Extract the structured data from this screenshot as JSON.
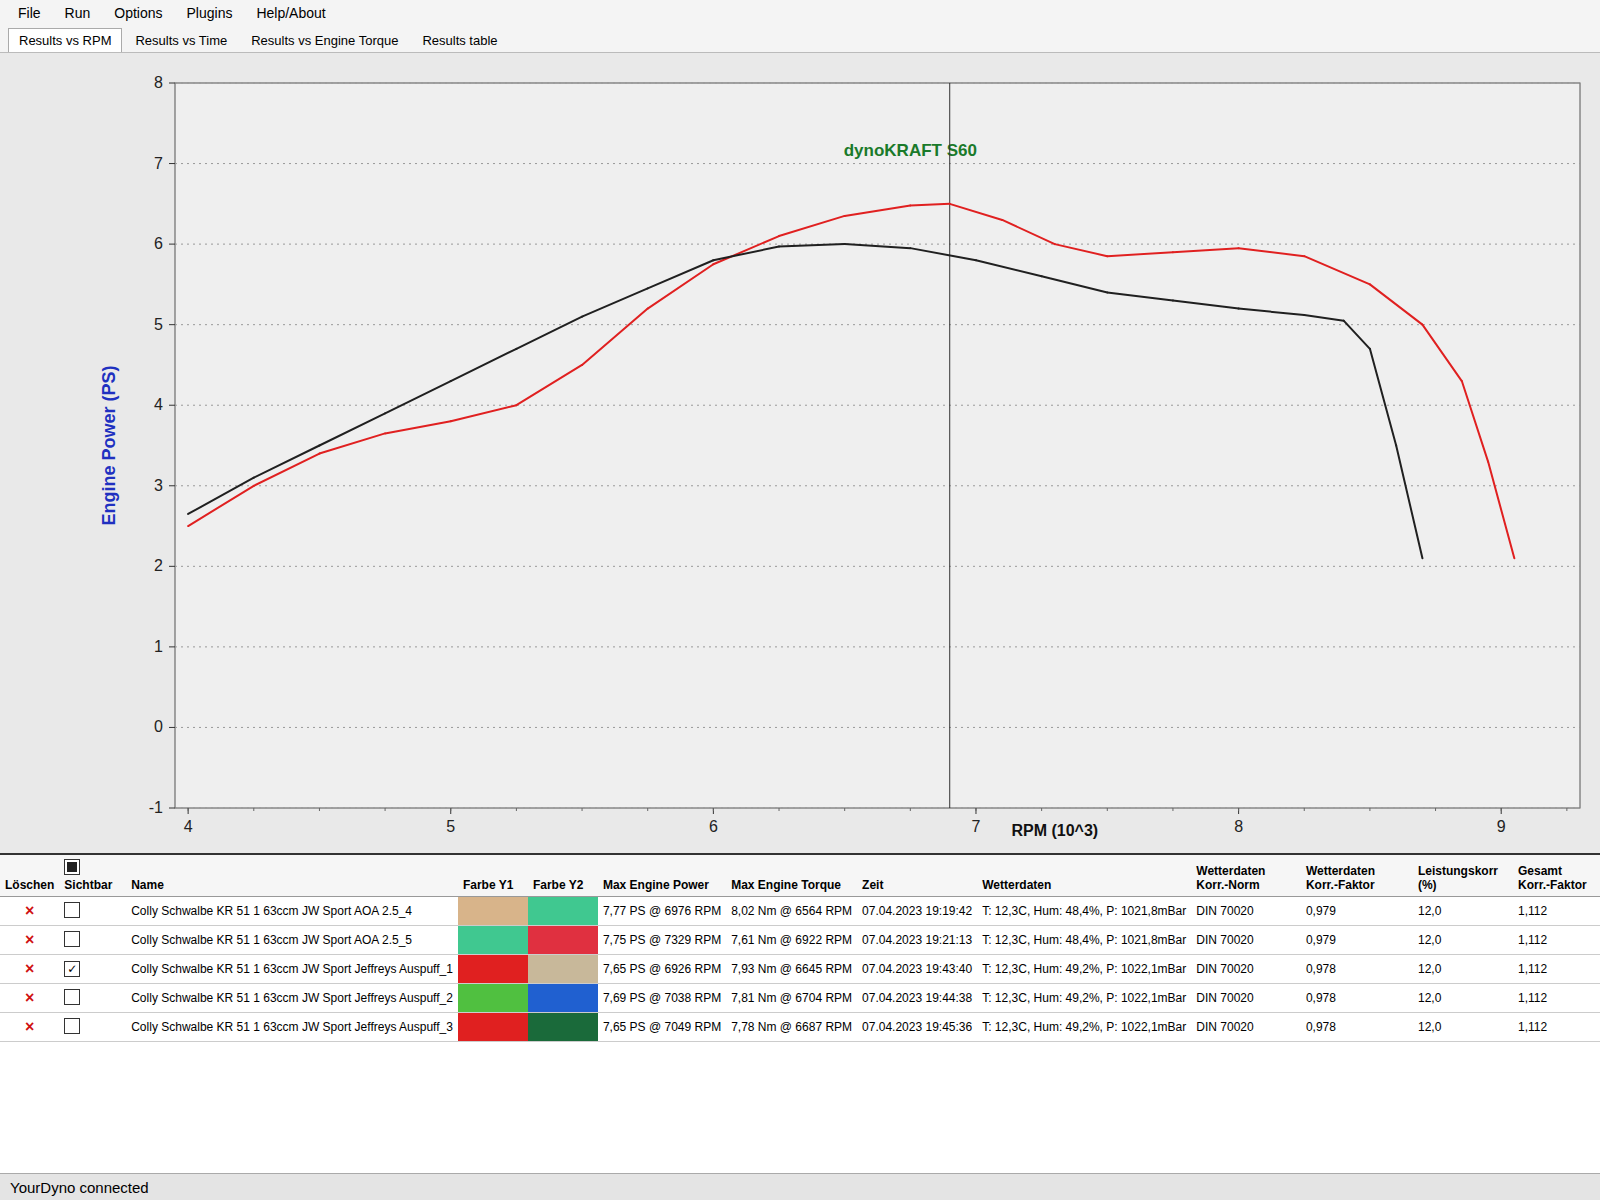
{
  "menu": [
    "File",
    "Run",
    "Options",
    "Plugins",
    "Help/About"
  ],
  "tabs": [
    {
      "label": "Results vs RPM",
      "selected": true
    },
    {
      "label": "Results vs Time",
      "selected": false
    },
    {
      "label": "Results vs Engine Torque",
      "selected": false
    },
    {
      "label": "Results table",
      "selected": false
    }
  ],
  "chart": {
    "title": "dynoKRAFT S60",
    "y_label": "Engine Power (PS)",
    "x_label": "RPM (10^3)",
    "y_ticks": [
      "-1",
      "0",
      "1",
      "2",
      "3",
      "4",
      "5",
      "6",
      "7",
      "8"
    ],
    "x_ticks": [
      "4",
      "5",
      "6",
      "7",
      "8",
      "9"
    ],
    "cursor_rpm": 6.9,
    "series": [
      {
        "color": "#e02020",
        "rpm": [
          4.0,
          4.25,
          4.5,
          4.75,
          5.0,
          5.25,
          5.5,
          5.75,
          6.0,
          6.25,
          6.5,
          6.75,
          6.9,
          7.1,
          7.3,
          7.5,
          7.75,
          8.0,
          8.25,
          8.5,
          8.7,
          8.85,
          8.95,
          9.05
        ],
        "values": [
          2.5,
          3.0,
          3.4,
          3.65,
          3.8,
          4.0,
          4.5,
          5.2,
          5.75,
          6.1,
          6.35,
          6.48,
          6.5,
          6.3,
          6.0,
          5.85,
          5.9,
          5.95,
          5.85,
          5.5,
          5.0,
          4.3,
          3.3,
          2.1
        ]
      },
      {
        "color": "#202020",
        "rpm": [
          4.0,
          4.25,
          4.5,
          4.75,
          5.0,
          5.25,
          5.5,
          5.75,
          6.0,
          6.25,
          6.5,
          6.75,
          7.0,
          7.25,
          7.5,
          7.75,
          8.0,
          8.25,
          8.4,
          8.5,
          8.6,
          8.7
        ],
        "values": [
          2.65,
          3.1,
          3.5,
          3.9,
          4.3,
          4.7,
          5.1,
          5.45,
          5.8,
          5.97,
          6.0,
          5.95,
          5.8,
          5.6,
          5.4,
          5.3,
          5.2,
          5.12,
          5.05,
          4.7,
          3.5,
          2.1
        ]
      }
    ]
  },
  "table": {
    "header_checkbox": {
      "checked": true
    },
    "columns": [
      "Löschen",
      "Sichtbar",
      "Name",
      "Farbe Y1",
      "Farbe Y2",
      "Max Engine Power",
      "Max Engine Torque",
      "Zeit",
      "Wetterdaten",
      "Wetterdaten Korr.-Norm",
      "Wetterdaten Korr.-Faktor",
      "Leistungskorr (%)",
      "Gesamt Korr.-Faktor"
    ],
    "rows": [
      {
        "delete": "×",
        "visible": false,
        "name": "Colly Schwalbe KR 51 1 63ccm JW Sport AOA 2.5_4",
        "y1": "#d8b48a",
        "y2": "#40c890",
        "power": "7,77 PS @ 6976 RPM",
        "torque": "8,02 Nm @ 6564 RPM",
        "time": "07.04.2023 19:19:42",
        "weather": "T: 12,3C, Hum: 48,4%, P: 1021,8mBar",
        "norm": "DIN 70020",
        "factor": "0,979",
        "corr": "12,0",
        "total": "1,112"
      },
      {
        "delete": "×",
        "visible": false,
        "name": "Colly Schwalbe KR 51 1 63ccm JW Sport AOA 2.5_5",
        "y1": "#40c890",
        "y2": "#e03040",
        "power": "7,75 PS @ 7329 RPM",
        "torque": "7,61 Nm @ 6922 RPM",
        "time": "07.04.2023 19:21:13",
        "weather": "T: 12,3C, Hum: 48,4%, P: 1021,8mBar",
        "norm": "DIN 70020",
        "factor": "0,979",
        "corr": "12,0",
        "total": "1,112"
      },
      {
        "delete": "×",
        "visible": true,
        "name": "Colly Schwalbe KR 51 1 63ccm JW Sport Jeffreys Auspuff_1",
        "y1": "#e02020",
        "y2": "#c8b89a",
        "power": "7,65 PS @ 6926 RPM",
        "torque": "7,93 Nm @ 6645 RPM",
        "time": "07.04.2023 19:43:40",
        "weather": "T: 12,3C, Hum: 49,2%, P: 1022,1mBar",
        "norm": "DIN 70020",
        "factor": "0,978",
        "corr": "12,0",
        "total": "1,112"
      },
      {
        "delete": "×",
        "visible": false,
        "name": "Colly Schwalbe KR 51 1 63ccm JW Sport Jeffreys Auspuff_2",
        "y1": "#50c040",
        "y2": "#2060d0",
        "power": "7,69 PS @ 7038 RPM",
        "torque": "7,81 Nm @ 6704 RPM",
        "time": "07.04.2023 19:44:38",
        "weather": "T: 12,3C, Hum: 49,2%, P: 1022,1mBar",
        "norm": "DIN 70020",
        "factor": "0,978",
        "corr": "12,0",
        "total": "1,112"
      },
      {
        "delete": "×",
        "visible": false,
        "name": "Colly Schwalbe KR 51 1 63ccm JW Sport Jeffreys Auspuff_3",
        "y1": "#e02020",
        "y2": "#1a6a3a",
        "power": "7,65 PS @ 7049 RPM",
        "torque": "7,78 Nm @ 6687 RPM",
        "time": "07.04.2023 19:45:36",
        "weather": "T: 12,3C, Hum: 49,2%, P: 1022,1mBar",
        "norm": "DIN 70020",
        "factor": "0,978",
        "corr": "12,0",
        "total": "1,112"
      }
    ]
  },
  "status_bar": "YourDyno connected"
}
